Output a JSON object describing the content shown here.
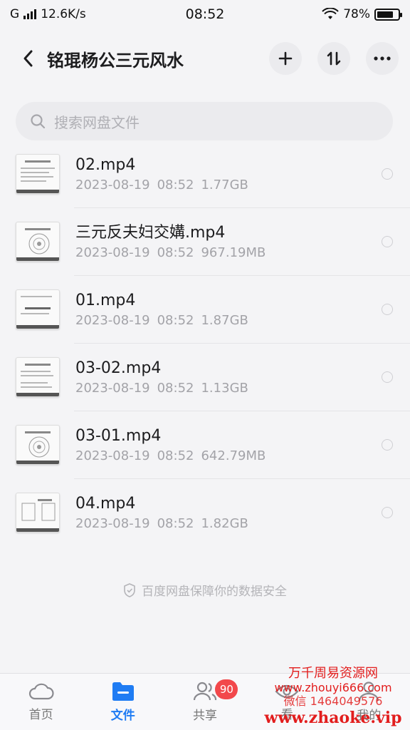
{
  "status_bar": {
    "network": "G",
    "speed": "12.6K/s",
    "time": "08:52",
    "battery": "78%",
    "battery_level": 0.78
  },
  "header": {
    "title": "铭琨杨公三元风水",
    "back_icon": "chevron-left-icon",
    "add_icon": "plus-icon",
    "sort_icon": "sort-icon",
    "more_icon": "more-icon"
  },
  "search": {
    "placeholder": "搜索网盘文件"
  },
  "files": [
    {
      "name": "02.mp4",
      "date": "2023-08-19",
      "time": "08:52",
      "size": "1.77GB"
    },
    {
      "name": "三元反夫妇交媾.mp4",
      "date": "2023-08-19",
      "time": "08:52",
      "size": "967.19MB"
    },
    {
      "name": "01.mp4",
      "date": "2023-08-19",
      "time": "08:52",
      "size": "1.87GB"
    },
    {
      "name": "03-02.mp4",
      "date": "2023-08-19",
      "time": "08:52",
      "size": "1.13GB"
    },
    {
      "name": "03-01.mp4",
      "date": "2023-08-19",
      "time": "08:52",
      "size": "642.79MB"
    },
    {
      "name": "04.mp4",
      "date": "2023-08-19",
      "time": "08:52",
      "size": "1.82GB"
    }
  ],
  "security_note": "百度网盘保障你的数据安全",
  "tabs": [
    {
      "label": "首页",
      "icon": "cloud-icon"
    },
    {
      "label": "文件",
      "icon": "folder-icon"
    },
    {
      "label": "共享",
      "icon": "people-icon",
      "badge": "90"
    },
    {
      "label": "看",
      "icon": "view-icon"
    },
    {
      "label": "我的",
      "icon": "user-icon"
    }
  ],
  "watermark": {
    "line1": "万千周易资源网",
    "line2": "www.zhouyi666.com",
    "line3": "微信 1464049576",
    "line4": "www.zhaoke.vip"
  },
  "colors": {
    "accent": "#1f7cf3",
    "badge": "#f2484b",
    "watermark": "#e21d1d"
  }
}
